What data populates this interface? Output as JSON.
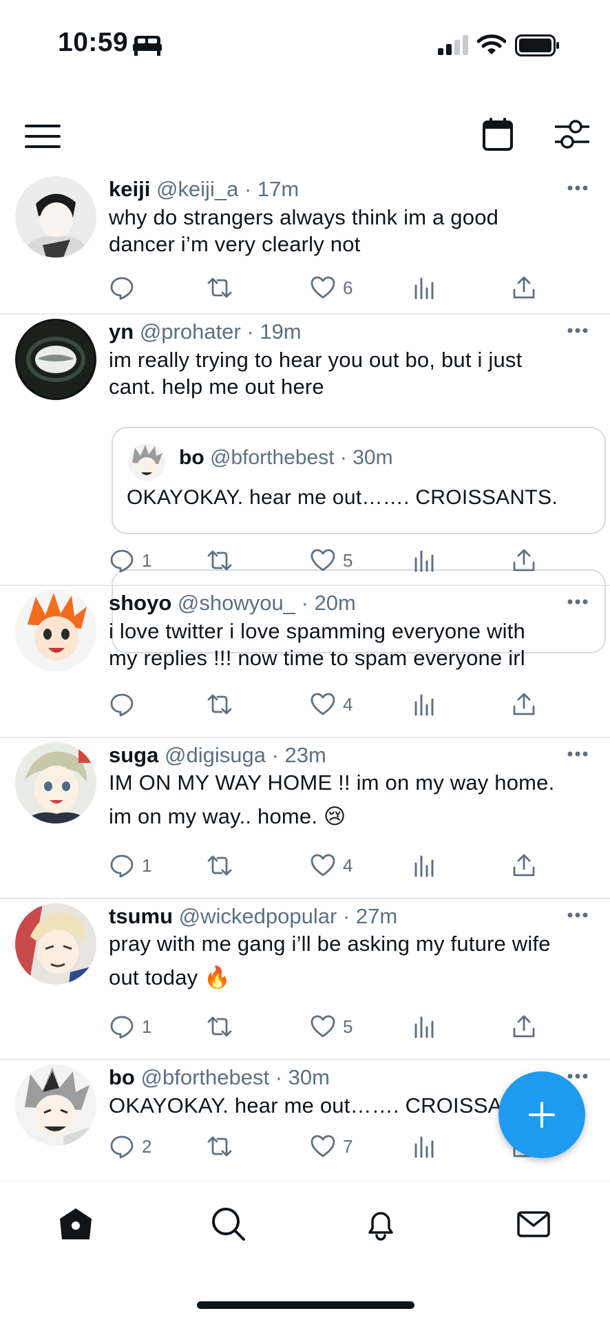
{
  "status_bar": {
    "time": "10:59"
  },
  "tweets": [
    {
      "name": "keiji",
      "handle": "@keiji_a",
      "sep": "·",
      "time": "17m",
      "lines": [
        "why do strangers always think im a good",
        "dancer i’m very clearly not"
      ],
      "replies": "",
      "retweets": "",
      "likes": "6"
    },
    {
      "name": "yn",
      "handle": "@prohater",
      "sep": "·",
      "time": "19m",
      "lines": [
        "im really trying to hear you out bo, but i just",
        "cant. help me out here"
      ],
      "quote": {
        "name": "bo",
        "handle": "@bforthebest",
        "sep": "·",
        "time": "30m",
        "text": "OKAYOKAY. hear me out……. CROISSANTS."
      },
      "replies": "1",
      "retweets": "",
      "likes": "5"
    },
    {
      "name": "shoyo",
      "handle": "@showyou_",
      "sep": "·",
      "time": "20m",
      "lines": [
        "i love twitter i love spamming everyone with",
        "my replies !!! now time to spam everyone irl"
      ],
      "replies": "",
      "retweets": "",
      "likes": "4"
    },
    {
      "name": "suga",
      "handle": "@digisuga",
      "sep": "·",
      "time": "23m",
      "lines": [
        "IM ON MY WAY HOME !! im on my way home.",
        "im on my way.. home. 😢"
      ],
      "replies": "1",
      "retweets": "",
      "likes": "4"
    },
    {
      "name": "tsumu",
      "handle": "@wickedpopular",
      "sep": "·",
      "time": "27m",
      "lines": [
        "pray with me gang i’ll be asking my future wife",
        "out today 🔥"
      ],
      "replies": "1",
      "retweets": "",
      "likes": "5"
    },
    {
      "name": "bo",
      "handle": "@bforthebest",
      "sep": "·",
      "time": "30m",
      "lines": [
        "OKAYOKAY. hear me out……. CROISSA"
      ],
      "replies": "2",
      "retweets": "",
      "likes": "7"
    }
  ],
  "icons": {
    "bed": "bed-icon",
    "signal": "cellular-signal-icon",
    "wifi": "wifi-icon",
    "battery": "battery-icon",
    "menu": "hamburger-menu-icon",
    "calendar": "calendar-icon",
    "filter": "filter-sliders-icon",
    "reply": "reply-bubble-icon",
    "retweet": "retweet-icon",
    "like": "heart-icon",
    "views": "views-chart-icon",
    "share": "share-icon",
    "compose": "plus-icon",
    "home": "home-icon",
    "search": "search-icon",
    "notifications": "bell-icon",
    "messages": "envelope-icon"
  },
  "colors": {
    "accent": "#1d9bf0",
    "meta_text": "#5b7083",
    "primary_text": "#0f1419",
    "divider": "#e6e9ec"
  }
}
